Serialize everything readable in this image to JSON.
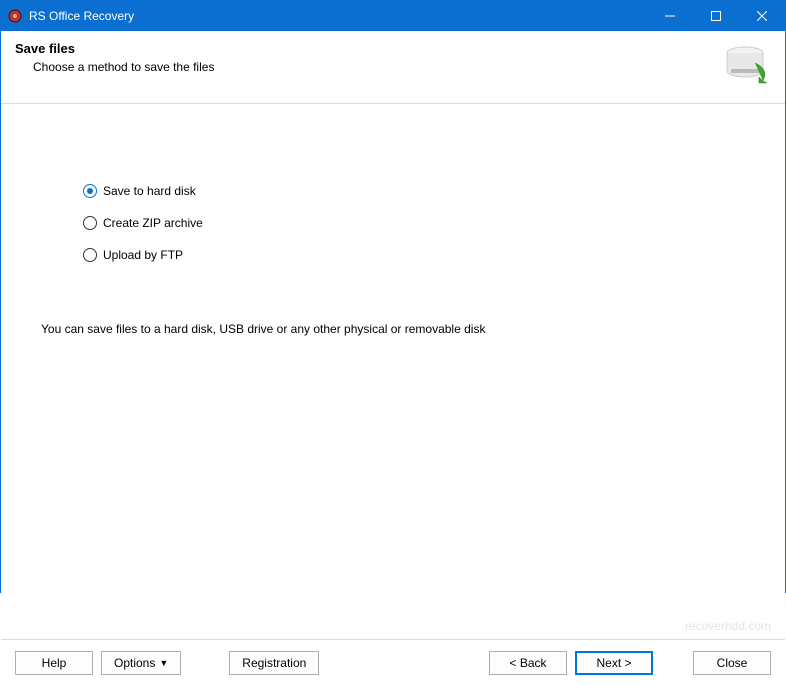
{
  "window": {
    "title": "RS Office Recovery"
  },
  "header": {
    "title": "Save files",
    "subtitle": "Choose a method to save the files"
  },
  "options": {
    "hard_disk": "Save to hard disk",
    "zip": "Create ZIP archive",
    "ftp": "Upload by FTP",
    "selected": "hard_disk"
  },
  "description": "You can save files to a hard disk, USB drive or any other physical or removable disk",
  "watermark": "recoverhdd.com",
  "footer": {
    "help": "Help",
    "options": "Options",
    "registration": "Registration",
    "back": "< Back",
    "next": "Next >",
    "close": "Close"
  }
}
